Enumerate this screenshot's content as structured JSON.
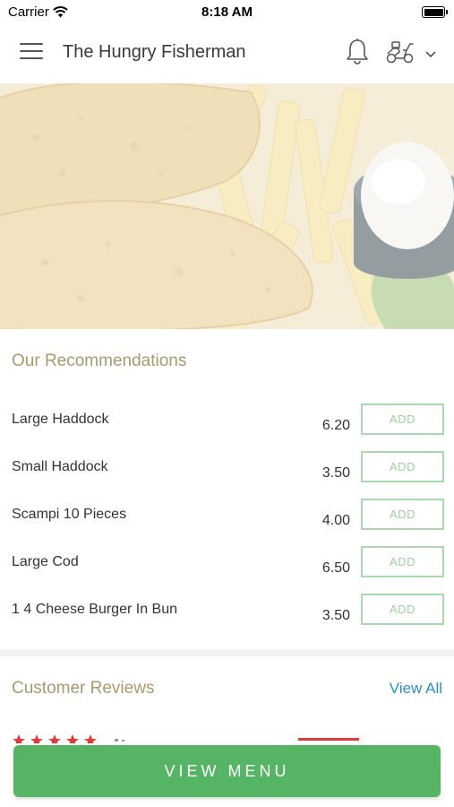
{
  "status_bar": {
    "carrier": "Carrier",
    "time": "8:18 AM"
  },
  "header": {
    "title": "The Hungry Fisherman"
  },
  "recommendations": {
    "title": "Our Recommendations",
    "add_label": "ADD",
    "items": [
      {
        "name": "Large Haddock",
        "price": "6.20"
      },
      {
        "name": "Small Haddock",
        "price": "3.50"
      },
      {
        "name": "Scampi 10 Pieces",
        "price": "4.00"
      },
      {
        "name": "Large Cod",
        "price": "6.50"
      },
      {
        "name": "1 4 Cheese Burger In Bun",
        "price": "3.50"
      }
    ]
  },
  "reviews": {
    "title": "Customer Reviews",
    "view_all": "View All"
  },
  "footer": {
    "view_menu": "VIEW MENU"
  },
  "colors": {
    "accent_green": "#56b565",
    "link_blue": "#2b8fc9",
    "section_title": "#a89a6e",
    "star_red": "#e03a3a"
  },
  "icons": [
    "hamburger-menu-icon",
    "bell-icon",
    "scooter-icon",
    "chevron-down-icon",
    "wifi-icon"
  ]
}
